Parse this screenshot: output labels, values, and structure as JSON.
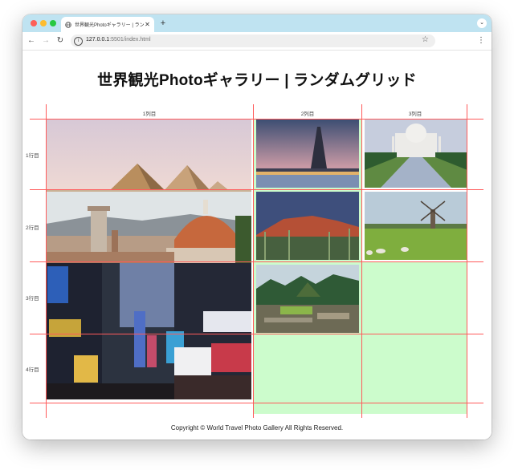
{
  "browser": {
    "tab_title": "世界観光Photoギャラリー | ラン...",
    "new_tab_symbol": "+",
    "address_host": "127.0.0.1",
    "address_path": ":5501/index.html"
  },
  "page": {
    "title": "世界観光Photoギャラリー | ランダムグリッド",
    "column_labels": [
      "1列目",
      "2列目",
      "3列目"
    ],
    "row_labels": [
      "1行目",
      "2行目",
      "3行目",
      "4行目"
    ],
    "footer": "Copyright © World Travel Photo Gallery All Rights Reserved."
  },
  "colors": {
    "grid_line": "#ff5a5a",
    "empty_cell": "#ccfccc",
    "tab_bar": "#bfe3f1"
  }
}
